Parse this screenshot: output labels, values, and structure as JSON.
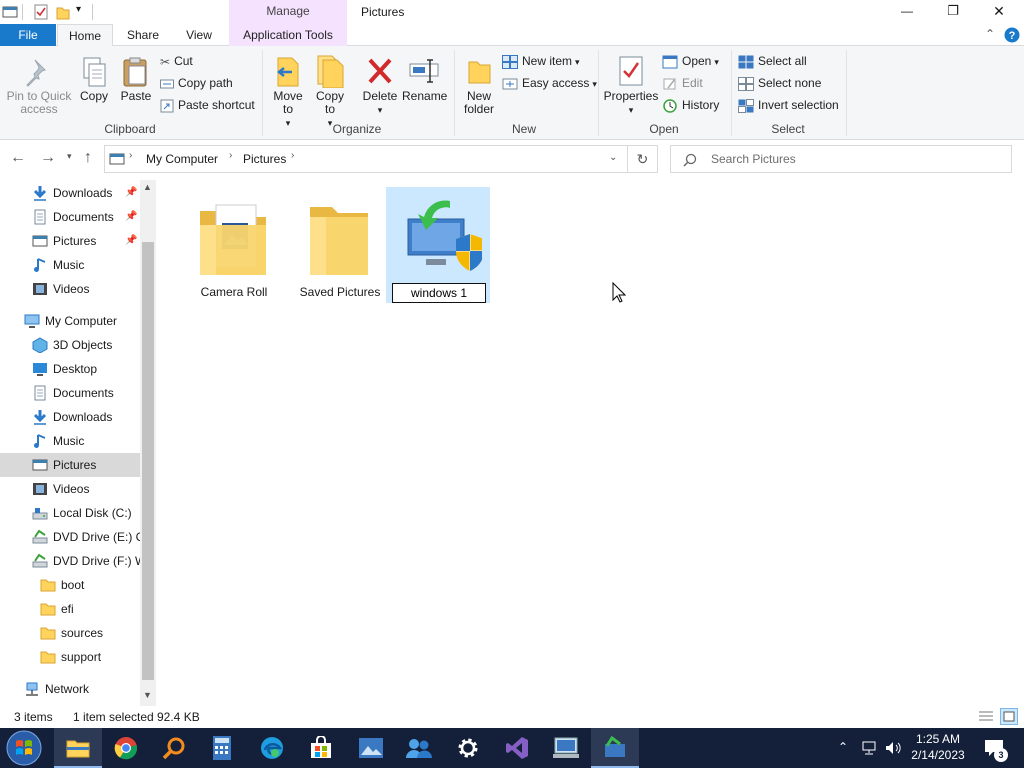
{
  "window": {
    "title": "Pictures",
    "context_tab": "Manage",
    "controls": {
      "minimize": "—",
      "restore": "❐",
      "close": "✕"
    }
  },
  "ribbon_tabs": [
    "File",
    "Home",
    "Share",
    "View",
    "Application Tools"
  ],
  "ribbon": {
    "clipboard": {
      "label": "Clipboard",
      "pin": "Pin to Quick access",
      "copy": "Copy",
      "paste": "Paste",
      "cut": "Cut",
      "copy_path": "Copy path",
      "paste_shortcut": "Paste shortcut"
    },
    "organize": {
      "label": "Organize",
      "move_to": "Move to",
      "copy_to": "Copy to",
      "delete": "Delete",
      "rename": "Rename"
    },
    "new": {
      "label": "New",
      "new_folder": "New folder",
      "new_item": "New item",
      "easy_access": "Easy access"
    },
    "open": {
      "label": "Open",
      "properties": "Properties",
      "open": "Open",
      "edit": "Edit",
      "history": "History"
    },
    "select": {
      "label": "Select",
      "select_all": "Select all",
      "select_none": "Select none",
      "invert": "Invert selection"
    }
  },
  "address": {
    "crumbs": [
      "My Computer",
      "Pictures"
    ],
    "search_placeholder": "Search Pictures"
  },
  "sidebar": {
    "quick": [
      {
        "label": "Downloads",
        "icon": "download-icon"
      },
      {
        "label": "Documents",
        "icon": "documents-icon"
      },
      {
        "label": "Pictures",
        "icon": "pictures-icon"
      },
      {
        "label": "Music",
        "icon": "music-icon"
      },
      {
        "label": "Videos",
        "icon": "videos-icon"
      }
    ],
    "computer": "My Computer",
    "computer_items": [
      {
        "label": "3D Objects",
        "icon": "3d-objects-icon"
      },
      {
        "label": "Desktop",
        "icon": "desktop-icon"
      },
      {
        "label": "Documents",
        "icon": "documents-icon"
      },
      {
        "label": "Downloads",
        "icon": "download-icon"
      },
      {
        "label": "Music",
        "icon": "music-icon"
      },
      {
        "label": "Pictures",
        "icon": "pictures-icon"
      },
      {
        "label": "Videos",
        "icon": "videos-icon"
      },
      {
        "label": "Local Disk (C:)",
        "icon": "drive-icon"
      },
      {
        "label": "DVD Drive (E:) CC",
        "icon": "dvd-icon"
      },
      {
        "label": "DVD Drive (F:) W",
        "icon": "dvd-icon"
      },
      {
        "label": "boot",
        "icon": "folder-icon"
      },
      {
        "label": "efi",
        "icon": "folder-icon"
      },
      {
        "label": "sources",
        "icon": "folder-icon"
      },
      {
        "label": "support",
        "icon": "folder-icon"
      }
    ],
    "network": "Network"
  },
  "files": [
    {
      "name": "Camera Roll",
      "type": "folder"
    },
    {
      "name": "Saved Pictures",
      "type": "folder"
    },
    {
      "name": "windows 1",
      "type": "app",
      "renaming": true
    }
  ],
  "status": {
    "count": "3 items",
    "selection": "1 item selected",
    "size": "92.4 KB"
  },
  "taskbar": {
    "time": "1:25 AM",
    "date": "2/14/2023",
    "notifications": "3"
  },
  "colors": {
    "file_tab": "#1979ca",
    "manage_tab": "#f5e2ff",
    "selection": "#cce8ff",
    "taskbar": "#14203a"
  }
}
